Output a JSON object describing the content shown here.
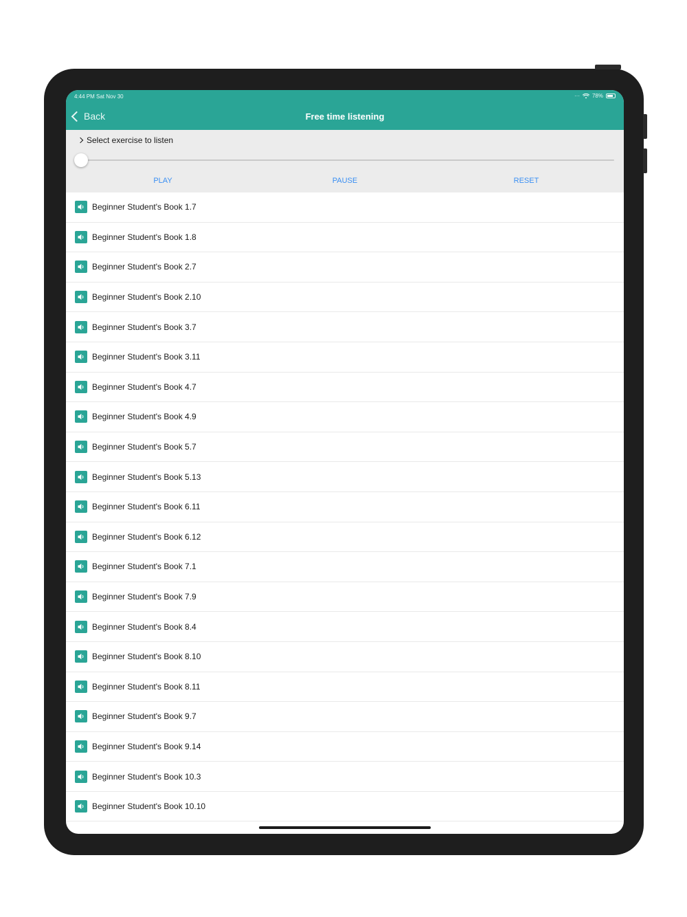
{
  "status": {
    "time": "4:44 PM  Sat Nov 30",
    "battery": "78%"
  },
  "nav": {
    "back_label": "Back",
    "title": "Free time listening"
  },
  "controls": {
    "select_label": "Select exercise to listen",
    "slider_position": 0,
    "play": "PLAY",
    "pause": "PAUSE",
    "reset": "RESET"
  },
  "list": {
    "items": [
      "Beginner Student's Book 1.7",
      "Beginner Student's Book 1.8",
      "Beginner Student's Book 2.7",
      "Beginner Student's Book 2.10",
      "Beginner Student's Book 3.7",
      "Beginner Student's Book 3.11",
      "Beginner Student's Book 4.7",
      "Beginner Student's Book 4.9",
      "Beginner Student's Book 5.7",
      "Beginner Student's Book 5.13",
      "Beginner Student's Book 6.11",
      "Beginner Student's Book 6.12",
      "Beginner Student's Book 7.1",
      "Beginner Student's Book 7.9",
      "Beginner Student's Book 8.4",
      "Beginner Student's Book 8.10",
      "Beginner Student's Book 8.11",
      "Beginner Student's Book 9.7",
      "Beginner Student's Book 9.14",
      "Beginner Student's Book 10.3",
      "Beginner Student's Book 10.10"
    ]
  },
  "colors": {
    "accent": "#2aa596",
    "button_text": "#3a8ff3",
    "controls_bg": "#ececec"
  },
  "icons": {
    "row_icon": "speaker-icon",
    "back_icon": "chevron-left-icon",
    "select_icon": "chevron-right-icon"
  }
}
